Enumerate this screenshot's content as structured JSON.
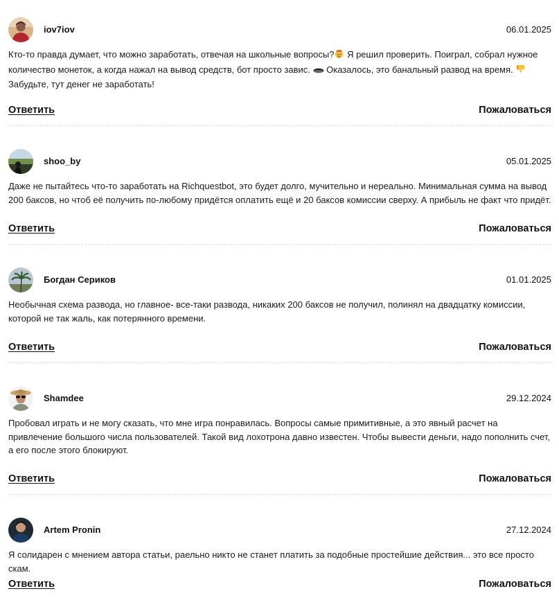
{
  "comments": [
    {
      "author": "iov7iov",
      "date": "06.01.2025",
      "avatar": "avatar-photo-red-shirt",
      "text_parts": [
        "Кто-то правда думает, что можно заработать, отвечая на школьные вопросы?",
        " Я решил проверить. Поиграл, собрал нужное количество монеток, а когда нажал на вывод средств, бот просто завис. ",
        " Оказалось, это банальный развод на время. ",
        " Забудьте, тут денег не заработать!"
      ],
      "emojis": [
        "exploding-head-emoji",
        "hole-emoji",
        "thumbs-down-emoji"
      ],
      "reply": "Ответить",
      "report": "Пожаловаться"
    },
    {
      "author": "shoo_by",
      "date": "05.01.2025",
      "avatar": "avatar-photo-landscape",
      "text": "Даже не пытайтесь что-то заработать на Richquestbot, это будет долго, мучительно и нереально. Минимальная сумма на вывод 200 баксов, но чтоб её получить по-любому придётся оплатить ещё и 20 баксов комиссии сверху. А прибыль не факт что придёт.",
      "reply": "Ответить",
      "report": "Пожаловаться"
    },
    {
      "author": "Богдан Сериков",
      "date": "01.01.2025",
      "avatar": "avatar-photo-palm-tree",
      "text": "Необычная схема развода, но главное- все-таки развода, никаких 200 баксов не получил, полинял на двадцатку комиссии, которой не так жаль, как потерянного времени.",
      "reply": "Ответить",
      "report": "Пожаловаться"
    },
    {
      "author": "Shamdee",
      "date": "29.12.2024",
      "avatar": "avatar-photo-man-in-hat",
      "text": "Пробовал играть и не могу сказать, что мне игра понравилась. Вопросы самые примитивные, а это явный расчет на привлечение большого числа пользователей. Такой вид лохотрона давно известен. Чтобы вывести деньги, надо пополнить счет, а его после этого блокируют.",
      "reply": "Ответить",
      "report": "Пожаловаться"
    },
    {
      "author": "Artem Pronin",
      "date": "27.12.2024",
      "avatar": "avatar-photo-man-dark",
      "text": "Я солидарен с мнением автора статьи, раельно никто не станет платить за подобные простейшие действия... это все просто скам.",
      "reply": "Ответить",
      "report": "Пожаловаться"
    }
  ],
  "colors": {
    "text": "#1a1a1a",
    "divider": "#dcdcdc"
  }
}
